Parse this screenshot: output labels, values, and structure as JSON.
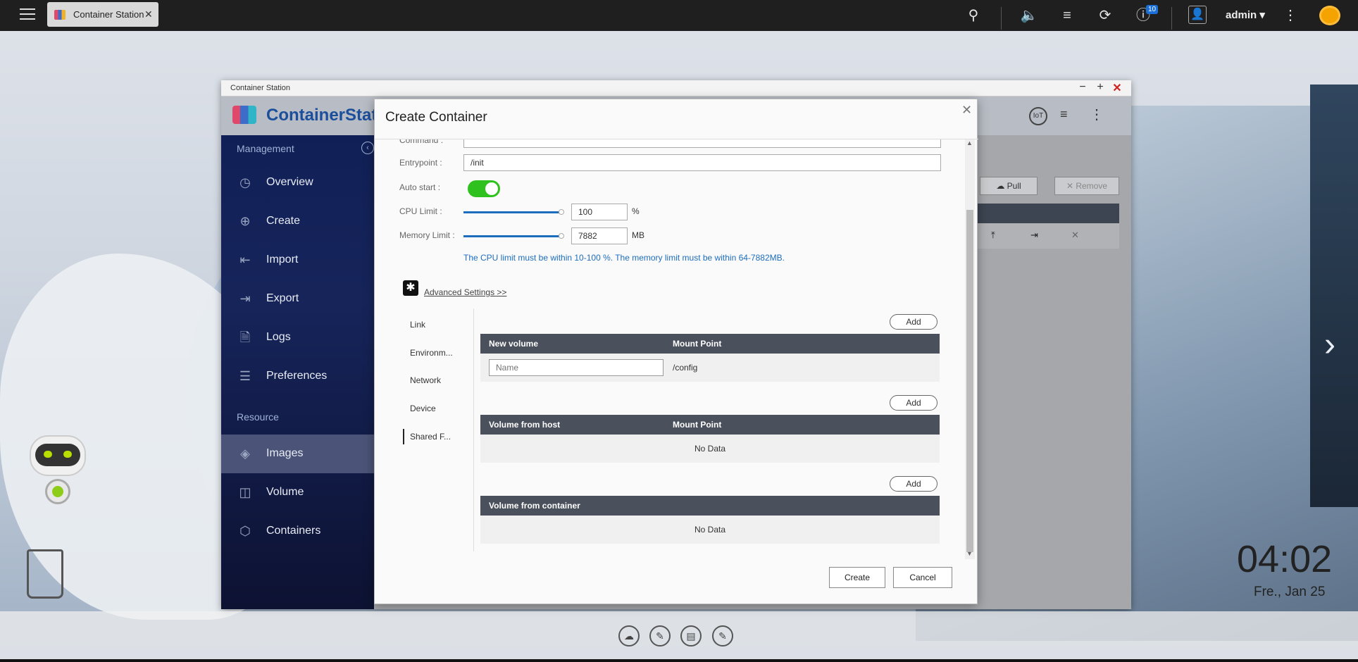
{
  "taskbar": {
    "tab_title": "Container Station",
    "notification_count": "10",
    "user": "admin ▾"
  },
  "window": {
    "title": "Container Station",
    "brand": "ContainerStati"
  },
  "sidebar": {
    "management_label": "Management",
    "resource_label": "Resource",
    "items": [
      {
        "label": "Overview",
        "icon": "overview-icon"
      },
      {
        "label": "Create",
        "icon": "create-icon"
      },
      {
        "label": "Import",
        "icon": "import-icon"
      },
      {
        "label": "Export",
        "icon": "export-icon"
      },
      {
        "label": "Logs",
        "icon": "logs-icon"
      },
      {
        "label": "Preferences",
        "icon": "preferences-icon"
      }
    ],
    "resource_items": [
      {
        "label": "Images",
        "icon": "images-icon"
      },
      {
        "label": "Volume",
        "icon": "volume-icon"
      },
      {
        "label": "Containers",
        "icon": "containers-icon"
      }
    ]
  },
  "background_toolbar": {
    "pull_label": "Pull",
    "remove_label": "Remove"
  },
  "dialog": {
    "title": "Create Container",
    "command_label": "Command :",
    "entrypoint_label": "Entrypoint :",
    "entrypoint_value": "/init",
    "autostart_label": "Auto start :",
    "autostart_on": true,
    "cpu_label": "CPU Limit :",
    "cpu_value": "100",
    "cpu_unit": "%",
    "memory_label": "Memory Limit :",
    "memory_value": "7882",
    "memory_unit": "MB",
    "limit_note": "The CPU limit must be within 10-100 %. The memory limit must be within 64-7882MB.",
    "advanced_label": "Advanced Settings >>",
    "subnav": [
      "Link",
      "Environm...",
      "Network",
      "Device",
      "Shared F..."
    ],
    "add_label": "Add",
    "table_new_volume": {
      "col1": "New volume",
      "col2": "Mount Point",
      "name_placeholder": "Name",
      "mount": "/config"
    },
    "table_host": {
      "col1": "Volume from host",
      "col2": "Mount Point",
      "empty": "No Data"
    },
    "table_container": {
      "col1": "Volume from container",
      "empty": "No Data"
    },
    "create_label": "Create",
    "cancel_label": "Cancel"
  },
  "desktop": {
    "time": "04:02",
    "date": "Fre., Jan 25"
  }
}
